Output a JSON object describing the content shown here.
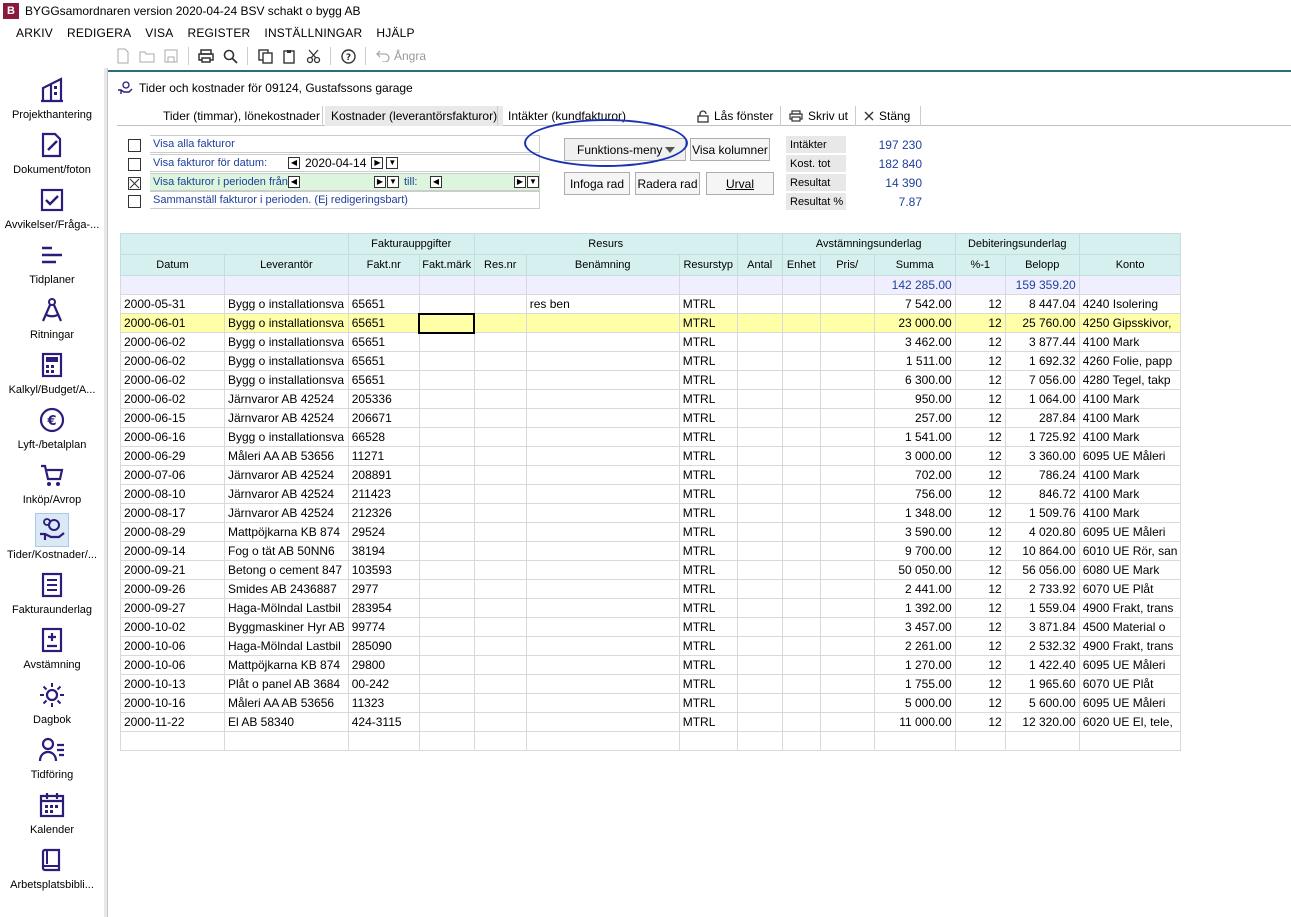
{
  "titlebar": {
    "icon_letter": "B",
    "title": "BYGGsamordnaren version 2020-04-24   BSV schakt o bygg AB"
  },
  "menu": [
    "ARKIV",
    "REDIGERA",
    "VISA",
    "REGISTER",
    "INSTÄLLNINGAR",
    "HJÄLP"
  ],
  "toolbar": {
    "undo_label": "Ångra"
  },
  "sidebar": [
    {
      "label": "Projekthantering",
      "icon": "building-icon"
    },
    {
      "label": "Dokument/foton",
      "icon": "document-edit-icon"
    },
    {
      "label": "Avvikelser/Fråga-...",
      "icon": "checkbox-icon"
    },
    {
      "label": "Tidplaner",
      "icon": "timeline-icon"
    },
    {
      "label": "Ritningar",
      "icon": "compass-icon"
    },
    {
      "label": "Kalkyl/Budget/A...",
      "icon": "calculator-icon"
    },
    {
      "label": "Lyft-/betalplan",
      "icon": "euro-icon"
    },
    {
      "label": "Inköp/Avrop",
      "icon": "cart-icon"
    },
    {
      "label": "Tider/Kostnader/...",
      "icon": "hand-money-icon"
    },
    {
      "label": "Fakturaunderlag",
      "icon": "invoice-icon"
    },
    {
      "label": "Avstämning",
      "icon": "plus-document-icon"
    },
    {
      "label": "Dagbok",
      "icon": "sun-icon"
    },
    {
      "label": "Tidföring",
      "icon": "person-list-icon"
    },
    {
      "label": "Kalender",
      "icon": "calendar-icon"
    },
    {
      "label": "Arbetsplatsbibli...",
      "icon": "book-icon"
    }
  ],
  "window_title": "Tider och kostnader för 09124, Gustafssons garage",
  "tabs": {
    "tider": "Tider (timmar), lönekostnader",
    "kostnader": "Kostnader (leverantörsfakturor)",
    "intakter": "Intäkter (kundfakturor)",
    "las": "Lås fönster",
    "skriv": "Skriv ut",
    "stang": "Stäng"
  },
  "filters": {
    "visa_alla": "Visa alla fakturor",
    "visa_datum": "Visa fakturor för datum:",
    "datum_value": "2020-04-14",
    "visa_perioden": "Visa fakturor i perioden från",
    "till": "till:",
    "sammanstall": "Sammanställ fakturor i perioden. (Ej redigeringsbart)"
  },
  "buttons": {
    "funktions_meny": "Funktions-meny",
    "visa_kolumner": "Visa kolumner",
    "infoga_rad": "Infoga rad",
    "radera_rad": "Radera rad",
    "urval": "Urval"
  },
  "summary": [
    {
      "label": "Intäkter",
      "value": "197 230"
    },
    {
      "label": "Kost. tot",
      "value": "182 840"
    },
    {
      "label": "Resultat",
      "value": "14 390"
    },
    {
      "label": "Resultat %",
      "value": "7.87"
    }
  ],
  "grid": {
    "group_headers": {
      "faktura": "Fakturauppgifter",
      "resurs": "Resurs",
      "avstamning": "Avstämningsunderlag",
      "debitering": "Debiteringsunderlag"
    },
    "columns": [
      "Datum",
      "Leverantör",
      "Fakt.nr",
      "Fakt.märk",
      "Res.nr",
      "Benämning",
      "Resurstyp",
      "Antal",
      "Enhet",
      "Pris/",
      "Summa",
      "%-1",
      "Belopp",
      "Konto"
    ],
    "totals": {
      "summa": "142 285.00",
      "belopp": "159 359.20"
    },
    "rows": [
      [
        "2000-05-31",
        "Bygg o installationsva",
        "65651",
        "",
        "",
        "res ben",
        "MTRL",
        "",
        "",
        "",
        "7 542.00",
        "12",
        "8 447.04",
        "4240 Isolering"
      ],
      [
        "2000-06-01",
        "Bygg o installationsva",
        "65651",
        "",
        "",
        "",
        "MTRL",
        "",
        "",
        "",
        "23 000.00",
        "12",
        "25 760.00",
        "4250 Gipsskivor,"
      ],
      [
        "2000-06-02",
        "Bygg o installationsva",
        "65651",
        "",
        "",
        "",
        "MTRL",
        "",
        "",
        "",
        "3 462.00",
        "12",
        "3 877.44",
        "4100 Mark"
      ],
      [
        "2000-06-02",
        "Bygg o installationsva",
        "65651",
        "",
        "",
        "",
        "MTRL",
        "",
        "",
        "",
        "1 511.00",
        "12",
        "1 692.32",
        "4260 Folie, papp"
      ],
      [
        "2000-06-02",
        "Bygg o installationsva",
        "65651",
        "",
        "",
        "",
        "MTRL",
        "",
        "",
        "",
        "6 300.00",
        "12",
        "7 056.00",
        "4280 Tegel, takp"
      ],
      [
        "2000-06-02",
        "Järnvaror AB 42524",
        "205336",
        "",
        "",
        "",
        "MTRL",
        "",
        "",
        "",
        "950.00",
        "12",
        "1 064.00",
        "4100 Mark"
      ],
      [
        "2000-06-15",
        "Järnvaror AB 42524",
        "206671",
        "",
        "",
        "",
        "MTRL",
        "",
        "",
        "",
        "257.00",
        "12",
        "287.84",
        "4100 Mark"
      ],
      [
        "2000-06-16",
        "Bygg o installationsva",
        "66528",
        "",
        "",
        "",
        "MTRL",
        "",
        "",
        "",
        "1 541.00",
        "12",
        "1 725.92",
        "4100 Mark"
      ],
      [
        "2000-06-29",
        "Måleri AA AB 53656",
        "11271",
        "",
        "",
        "",
        "MTRL",
        "",
        "",
        "",
        "3 000.00",
        "12",
        "3 360.00",
        "6095 UE Måleri"
      ],
      [
        "2000-07-06",
        "Järnvaror AB 42524",
        "208891",
        "",
        "",
        "",
        "MTRL",
        "",
        "",
        "",
        "702.00",
        "12",
        "786.24",
        "4100 Mark"
      ],
      [
        "2000-08-10",
        "Järnvaror AB 42524",
        "211423",
        "",
        "",
        "",
        "MTRL",
        "",
        "",
        "",
        "756.00",
        "12",
        "846.72",
        "4100 Mark"
      ],
      [
        "2000-08-17",
        "Järnvaror AB 42524",
        "212326",
        "",
        "",
        "",
        "MTRL",
        "",
        "",
        "",
        "1 348.00",
        "12",
        "1 509.76",
        "4100 Mark"
      ],
      [
        "2000-08-29",
        "Mattpöjkarna KB 874",
        "29524",
        "",
        "",
        "",
        "MTRL",
        "",
        "",
        "",
        "3 590.00",
        "12",
        "4 020.80",
        "6095 UE Måleri"
      ],
      [
        "2000-09-14",
        "Fog o tät AB 50NN6",
        "38194",
        "",
        "",
        "",
        "MTRL",
        "",
        "",
        "",
        "9 700.00",
        "12",
        "10 864.00",
        "6010 UE Rör, san"
      ],
      [
        "2000-09-21",
        "Betong o cement 847",
        "103593",
        "",
        "",
        "",
        "MTRL",
        "",
        "",
        "",
        "50 050.00",
        "12",
        "56 056.00",
        "6080 UE Mark"
      ],
      [
        "2000-09-26",
        "Smides AB 2436887",
        "2977",
        "",
        "",
        "",
        "MTRL",
        "",
        "",
        "",
        "2 441.00",
        "12",
        "2 733.92",
        "6070 UE Plåt"
      ],
      [
        "2000-09-27",
        "Haga-Mölndal Lastbil",
        "283954",
        "",
        "",
        "",
        "MTRL",
        "",
        "",
        "",
        "1 392.00",
        "12",
        "1 559.04",
        "4900 Frakt, trans"
      ],
      [
        "2000-10-02",
        "Byggmaskiner Hyr AB",
        "99774",
        "",
        "",
        "",
        "MTRL",
        "",
        "",
        "",
        "3 457.00",
        "12",
        "3 871.84",
        "4500 Material o"
      ],
      [
        "2000-10-06",
        "Haga-Mölndal Lastbil",
        "285090",
        "",
        "",
        "",
        "MTRL",
        "",
        "",
        "",
        "2 261.00",
        "12",
        "2 532.32",
        "4900 Frakt, trans"
      ],
      [
        "2000-10-06",
        "Mattpöjkarna KB 874",
        "29800",
        "",
        "",
        "",
        "MTRL",
        "",
        "",
        "",
        "1 270.00",
        "12",
        "1 422.40",
        "6095 UE Måleri"
      ],
      [
        "2000-10-13",
        "Plåt o panel AB 3684",
        "00-242",
        "",
        "",
        "",
        "MTRL",
        "",
        "",
        "",
        "1 755.00",
        "12",
        "1 965.60",
        "6070 UE Plåt"
      ],
      [
        "2000-10-16",
        "Måleri AA AB 53656",
        "11323",
        "",
        "",
        "",
        "MTRL",
        "",
        "",
        "",
        "5 000.00",
        "12",
        "5 600.00",
        "6095 UE Måleri"
      ],
      [
        "2000-11-22",
        "El AB 58340",
        "424-3115",
        "",
        "",
        "",
        "MTRL",
        "",
        "",
        "",
        "11 000.00",
        "12",
        "12 320.00",
        "6020 UE El, tele,"
      ]
    ]
  }
}
